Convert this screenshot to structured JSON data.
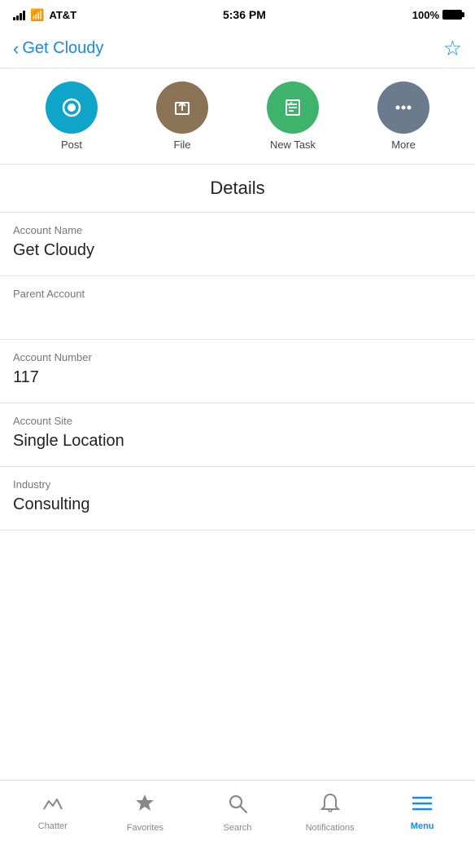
{
  "status_bar": {
    "carrier": "AT&T",
    "time": "5:36 PM",
    "battery": "100%"
  },
  "nav": {
    "back_label": "Get Cloudy",
    "star_char": "☆"
  },
  "quick_actions": [
    {
      "id": "post",
      "label": "Post",
      "color_class": "action-post"
    },
    {
      "id": "file",
      "label": "File",
      "color_class": "action-file"
    },
    {
      "id": "new-task",
      "label": "New Task",
      "color_class": "action-task"
    },
    {
      "id": "more",
      "label": "More",
      "color_class": "action-more"
    }
  ],
  "section_title": "Details",
  "fields": [
    {
      "id": "account-name",
      "label": "Account Name",
      "value": "Get Cloudy"
    },
    {
      "id": "parent-account",
      "label": "Parent Account",
      "value": ""
    },
    {
      "id": "account-number",
      "label": "Account Number",
      "value": "117"
    },
    {
      "id": "account-site",
      "label": "Account Site",
      "value": "Single Location"
    },
    {
      "id": "industry",
      "label": "Industry",
      "value": "Consulting"
    }
  ],
  "tabs": [
    {
      "id": "chatter",
      "label": "Chatter",
      "active": false
    },
    {
      "id": "favorites",
      "label": "Favorites",
      "active": false
    },
    {
      "id": "search",
      "label": "Search",
      "active": false
    },
    {
      "id": "notifications",
      "label": "Notifications",
      "active": false
    },
    {
      "id": "menu",
      "label": "Menu",
      "active": true
    }
  ]
}
